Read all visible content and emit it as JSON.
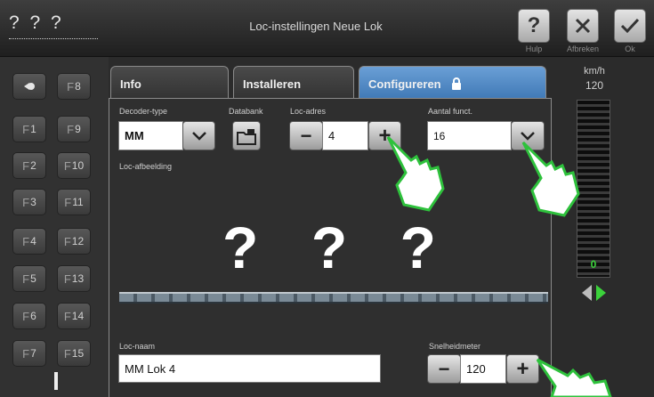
{
  "header": {
    "loco_name": "? ? ?",
    "title": "Loc-instellingen Neue Lok"
  },
  "toolbar": {
    "help_label": "Hulp",
    "cancel_label": "Afbreken",
    "ok_label": "Ok",
    "help_icon": "?"
  },
  "function_keys": [
    {
      "label": "",
      "icon": "light-icon"
    },
    {
      "label": "8"
    },
    {
      "label": "1"
    },
    {
      "label": "9"
    },
    {
      "label": "2"
    },
    {
      "label": "10"
    },
    {
      "label": "3"
    },
    {
      "label": "11"
    },
    {
      "label": "4"
    },
    {
      "label": "12"
    },
    {
      "label": "5"
    },
    {
      "label": "13"
    },
    {
      "label": "6"
    },
    {
      "label": "14"
    },
    {
      "label": "7"
    },
    {
      "label": "15"
    }
  ],
  "tabs": [
    {
      "label": "Info"
    },
    {
      "label": "Installeren"
    },
    {
      "label": "Configureren",
      "active": true,
      "icon": "lock-icon"
    }
  ],
  "config": {
    "decoder_type_label": "Decoder-type",
    "decoder_type": "MM",
    "database_label": "Databank",
    "loc_address_label": "Loc-adres",
    "loc_address": "4",
    "func_count_label": "Aantal funct.",
    "func_count": "16",
    "image_label": "Loc-afbeelding",
    "image_placeholder": [
      "?",
      "?",
      "?"
    ],
    "loc_name_label": "Loc-naam",
    "loc_name": "MM Lok 4",
    "speedometer_label": "Snelheidmeter",
    "speedometer": "120"
  },
  "speed": {
    "unit": "km/h",
    "max": "120",
    "current": "0"
  },
  "colors": {
    "accent_tab": "#4f8ac8",
    "speed_green": "#3bd23b",
    "hand_green": "#2ec13c"
  }
}
